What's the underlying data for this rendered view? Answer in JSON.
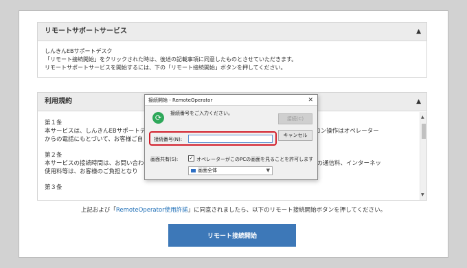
{
  "support_panel": {
    "title": "リモートサポートサービス",
    "lines": [
      "しんきんEBサポートデスク",
      "「リモート接続開始」をクリックされた時は、後述の記載事項に同意したものとさせていただきます。",
      "リモートサポートサービスを開始するには、下の「リモート接続開始」ボタンを押してください。"
    ]
  },
  "terms_panel": {
    "title": "利用規約",
    "articles": [
      {
        "heading": "第１条",
        "lines": [
          "本サービスは、しんきんEBサポートデ",
          "からの電話にもとづいて、お客様ご自"
        ],
        "lines_right": [
          "際のパソコン操作はオペレーター",
          ""
        ]
      },
      {
        "heading": "第２条",
        "lines": [
          "本サービスの接続時間は、お問い合わ",
          "使用料等は、お客様のご負担となり"
        ],
        "lines_right": [
          "ご利用中の通信料、インターネッ",
          ""
        ]
      },
      {
        "heading": "第３条",
        "lines": [],
        "lines_right": []
      }
    ]
  },
  "agreement": {
    "before": "上記および「",
    "link": "RemoteOperator使用許諾",
    "after": "」に同意されましたら、以下のリモート接続開始ボタンを押してください。"
  },
  "connect_button_label": "リモート接続開始",
  "dialog": {
    "title": "接続開始 - RemoteOperator",
    "prompt": "接続番号をご入力ください。",
    "connect_label": "接続(C)",
    "cancel_label": "キャンセル",
    "number_label": "接続番号(N):",
    "number_value": "",
    "share_label": "画面共有(S):",
    "share_checkbox_label": "オペレーターがこのPCの画面を見ることを許可します",
    "share_checked": true,
    "screen_option": "画面全体",
    "close_glyph": "✕"
  },
  "colors": {
    "accent_button": "#3d78b8",
    "link": "#1f6fb7",
    "highlight_border": "#d21e2b",
    "dialog_icon": "#2ea85a"
  }
}
